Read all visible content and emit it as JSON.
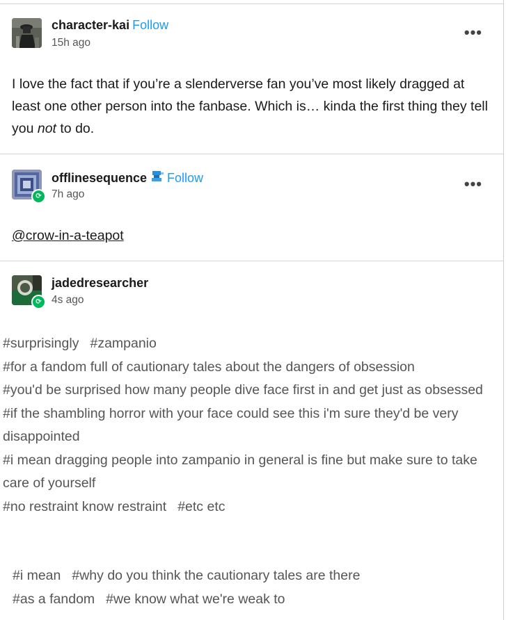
{
  "posts": [
    {
      "username": "character-kai",
      "follow_label": "Follow",
      "time": "15h ago",
      "text_before": "I love the fact that if you’re a slenderverse fan you’ve most likely dragged at least one other person into the fanbase. Which is… kinda the first thing they tell you ",
      "text_em": "not",
      "text_after": " to do.",
      "more_icon": "ellipsis-icon"
    },
    {
      "username": "offlinesequence",
      "follow_label": "Follow",
      "time": "7h ago",
      "mention": "@crow-in-a-teapot",
      "more_icon": "ellipsis-icon",
      "badge_icon": "reblog-icon"
    },
    {
      "username": "jadedresearcher",
      "time": "4s ago",
      "badge_icon": "reblog-icon",
      "tags": [
        "#surprisingly",
        "#zampanio",
        "#for a fandom full of cautionary tales about the dangers of obsession",
        "#you'd be surprised how many people dive face first in and get just as obsessed",
        "#if the shambling horror with your face could see this i'm sure they'd be very disappointed",
        "#i mean dragging people into zampanio in general is fine but make sure to take care of yourself",
        "#no restraint know restraint",
        "#etc etc",
        "#i mean",
        "#why do you think the cautionary tales are there",
        "#as a fandom",
        "#we know what we're weak to"
      ]
    }
  ],
  "colors": {
    "follow": "#1d9bf0",
    "reblog_badge": "#00b85c",
    "tag_text": "#555555"
  }
}
